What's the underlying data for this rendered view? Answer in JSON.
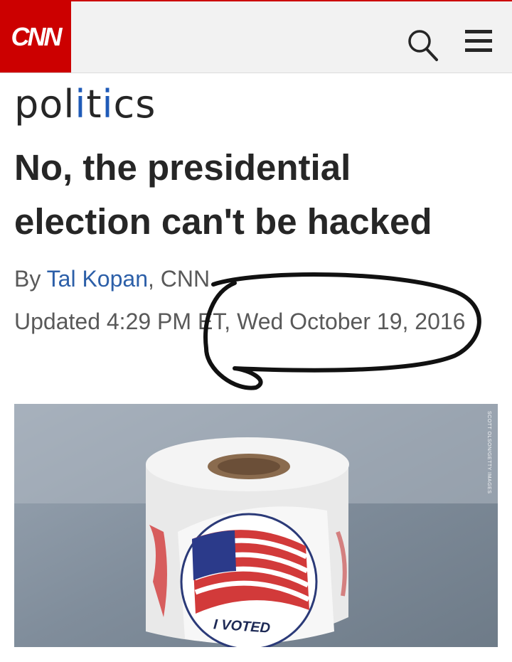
{
  "header": {
    "logo_text": "CNN",
    "search_icon": "search-icon",
    "menu_icon": "hamburger-menu-icon",
    "brand_color": "#cc0000"
  },
  "section": {
    "part1": "pol",
    "part2": "i",
    "part3": "t",
    "part4": "i",
    "part5": "cs"
  },
  "article": {
    "headline": "No, the presidential election can't be hacked",
    "byline_prefix": "By ",
    "author": "Tal Kopan",
    "byline_suffix": ", CNN",
    "updated": "Updated 4:29 PM ET, Wed October 19, 2016"
  },
  "image": {
    "credit": "SCOTT OLSON/GETTY IMAGES",
    "sticker_text": "I VOTED"
  }
}
